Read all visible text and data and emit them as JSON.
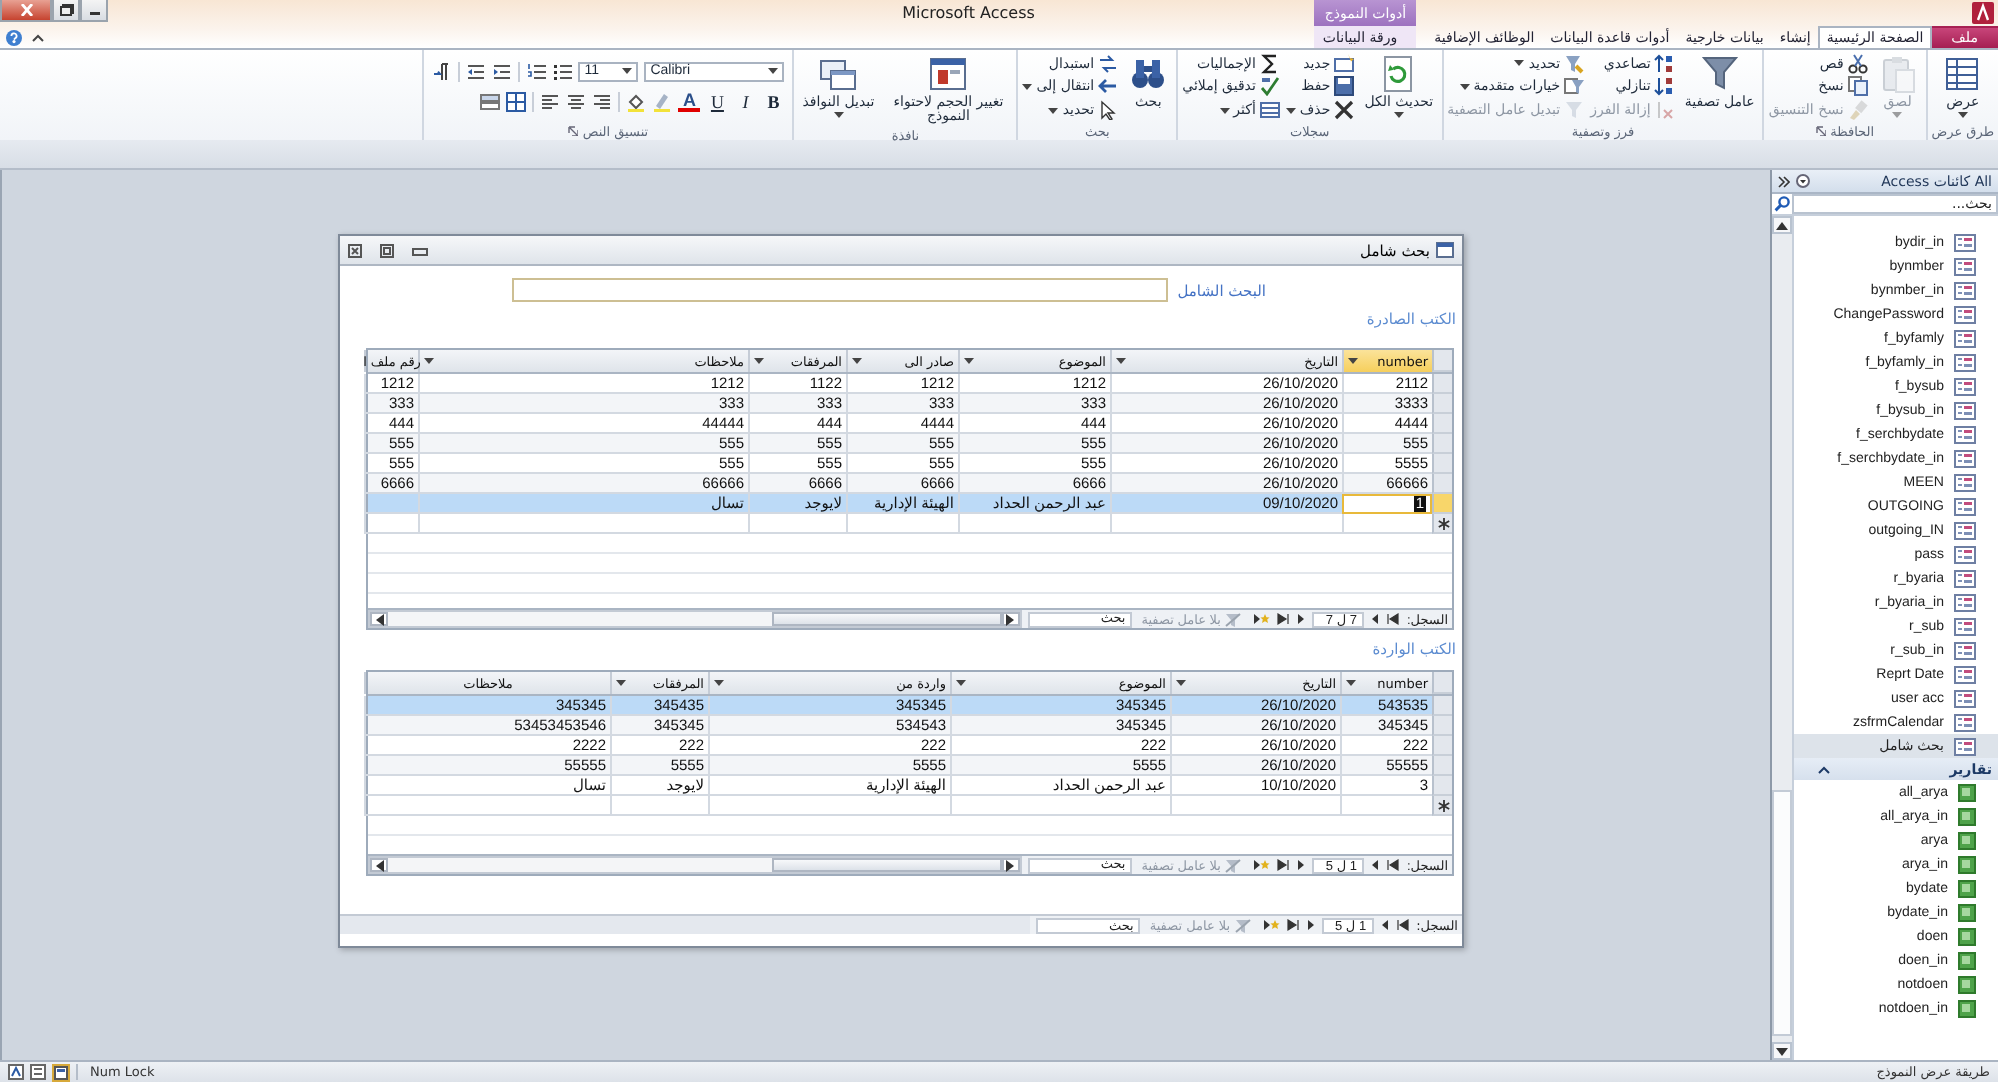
{
  "window": {
    "title": "Microsoft Access"
  },
  "tabs": [
    {
      "label": "ملف",
      "kind": "file",
      "selected": false
    },
    {
      "label": "الصفحة الرئيسية",
      "kind": "tab",
      "selected": true
    },
    {
      "label": "إنشاء",
      "kind": "tab",
      "selected": false
    },
    {
      "label": "بيانات خارجية",
      "kind": "tab",
      "selected": false
    },
    {
      "label": "أدوات قاعدة البيانات",
      "kind": "tab",
      "selected": false
    },
    {
      "label": "الوظائف الإضافية",
      "kind": "tab",
      "selected": false
    },
    {
      "label": "ورقة البيانات",
      "kind": "context",
      "group": "أدوات النموذج",
      "selected": false
    }
  ],
  "ribbon": {
    "groups": [
      {
        "label": "طرق عرض",
        "kind": "buttons",
        "launcher": false,
        "items": [
          {
            "label": "عرض",
            "kind": "large",
            "disabled": false,
            "dropdown": true
          }
        ]
      },
      {
        "label": "الحافظة",
        "kind": "buttons",
        "launcher": true,
        "items": [
          {
            "label": "لصق",
            "kind": "large",
            "disabled": true,
            "dropdown": true
          },
          {
            "label": "قص",
            "kind": "small",
            "disabled": false,
            "dropdown": false
          },
          {
            "label": "نسخ",
            "kind": "small",
            "disabled": false,
            "dropdown": false
          },
          {
            "label": "نسخ التنسيق",
            "kind": "small",
            "disabled": true,
            "dropdown": false
          }
        ]
      },
      {
        "label": "فرز وتصفية",
        "kind": "buttons",
        "launcher": false,
        "items": [
          {
            "label": "عامل تصفية",
            "kind": "large",
            "disabled": false,
            "dropdown": false
          },
          {
            "label": "تصاعدي",
            "kind": "small",
            "disabled": false,
            "dropdown": false
          },
          {
            "label": "تنازلي",
            "kind": "small",
            "disabled": false,
            "dropdown": false
          },
          {
            "label": "إزالة الفرز",
            "kind": "small",
            "disabled": true,
            "dropdown": false
          },
          {
            "label": "تحديد",
            "kind": "small",
            "disabled": false,
            "dropdown": true
          },
          {
            "label": "خيارات متقدمة",
            "kind": "small",
            "disabled": false,
            "dropdown": true
          },
          {
            "label": "تبديل عامل التصفية",
            "kind": "small",
            "disabled": true,
            "dropdown": false
          }
        ]
      },
      {
        "label": "سجلات",
        "kind": "buttons",
        "launcher": false,
        "items": [
          {
            "label": "تحديث الكل",
            "kind": "large",
            "disabled": false,
            "dropdown": true
          },
          {
            "label": "جديد",
            "kind": "small",
            "disabled": false,
            "dropdown": false
          },
          {
            "label": "حفظ",
            "kind": "small",
            "disabled": false,
            "dropdown": false
          },
          {
            "label": "حذف",
            "kind": "small",
            "disabled": false,
            "dropdown": true
          },
          {
            "label": "الإجماليات",
            "kind": "small",
            "disabled": false,
            "dropdown": false
          },
          {
            "label": "تدقيق إملائي",
            "kind": "small",
            "disabled": false,
            "dropdown": false
          },
          {
            "label": "أكثر",
            "kind": "small",
            "disabled": false,
            "dropdown": true
          }
        ]
      },
      {
        "label": "بحث",
        "kind": "buttons",
        "launcher": false,
        "items": [
          {
            "label": "بحث",
            "kind": "large",
            "disabled": false,
            "dropdown": false
          },
          {
            "label": "استبدال",
            "kind": "small",
            "disabled": false,
            "dropdown": false
          },
          {
            "label": "انتقال إلى",
            "kind": "small",
            "disabled": false,
            "dropdown": true
          },
          {
            "label": "تحديد",
            "kind": "small",
            "disabled": false,
            "dropdown": true
          }
        ]
      },
      {
        "label": "نافذة",
        "kind": "buttons",
        "launcher": false,
        "items": [
          {
            "label": "تغيير الحجم لاحتواء النموذج",
            "kind": "large",
            "disabled": false,
            "dropdown": false
          },
          {
            "label": "تبديل النوافذ",
            "kind": "large",
            "disabled": false,
            "dropdown": true
          }
        ]
      },
      {
        "label": "تنسيق النص",
        "kind": "format",
        "launcher": true,
        "font": "Calibri",
        "size": "11",
        "items": [
          {
            "label": "B",
            "kind": "bold"
          },
          {
            "label": "I",
            "kind": "italic"
          },
          {
            "label": "U",
            "kind": "underline"
          },
          {
            "label": "A",
            "kind": "color"
          }
        ]
      }
    ]
  },
  "nav_pane": {
    "title": "All كائنات Access",
    "search": {
      "placeholder": "بحث..."
    },
    "forms": [
      {
        "label": "bydir_in",
        "selected": false
      },
      {
        "label": "bynmber",
        "selected": false
      },
      {
        "label": "bynmber_in",
        "selected": false
      },
      {
        "label": "ChangePassword",
        "selected": false
      },
      {
        "label": "f_byfamly",
        "selected": false
      },
      {
        "label": "f_byfamly_in",
        "selected": false
      },
      {
        "label": "f_bysub",
        "selected": false
      },
      {
        "label": "f_bysub_in",
        "selected": false
      },
      {
        "label": "f_serchbydate",
        "selected": false
      },
      {
        "label": "f_serchbydate_in",
        "selected": false
      },
      {
        "label": "MEEN",
        "selected": false
      },
      {
        "label": "OUTGOING",
        "selected": false
      },
      {
        "label": "outgoing_IN",
        "selected": false
      },
      {
        "label": "pass",
        "selected": false
      },
      {
        "label": "r_byaria",
        "selected": false
      },
      {
        "label": "r_byaria_in",
        "selected": false
      },
      {
        "label": "r_sub",
        "selected": false
      },
      {
        "label": "r_sub_in",
        "selected": false
      },
      {
        "label": "Reprt Date",
        "selected": false
      },
      {
        "label": "user acc",
        "selected": false
      },
      {
        "label": "zsfrmCalendar",
        "selected": false
      },
      {
        "label": "بحث شامل",
        "selected": true
      }
    ],
    "reports": {
      "title": "تقارير",
      "items": [
        {
          "label": "all_arya",
          "selected": false
        },
        {
          "label": "all_arya_in",
          "selected": false
        },
        {
          "label": "arya",
          "selected": false
        },
        {
          "label": "arya_in",
          "selected": false
        },
        {
          "label": "bydate",
          "selected": false
        },
        {
          "label": "bydate_in",
          "selected": false
        },
        {
          "label": "doen",
          "selected": false
        },
        {
          "label": "doen_in",
          "selected": false
        },
        {
          "label": "notdoen",
          "selected": false
        },
        {
          "label": "notdoen_in",
          "selected": false
        }
      ]
    }
  },
  "form": {
    "title": "بحث شامل",
    "search": {
      "label": "البحث الشامل"
    },
    "subforms": [
      {
        "title": "الكتب الصادرة",
        "columns": [
          {
            "label": "number",
            "selected": true,
            "dropdown": true
          },
          {
            "label": "التاريخ",
            "selected": false,
            "dropdown": true
          },
          {
            "label": "الموضوع",
            "selected": false,
            "dropdown": true
          },
          {
            "label": "صادر الى",
            "selected": false,
            "dropdown": true
          },
          {
            "label": "المرفقات",
            "selected": false,
            "dropdown": true
          },
          {
            "label": "ملاحظات",
            "selected": false,
            "dropdown": true
          },
          {
            "label": "رقم ملف ا",
            "selected": false,
            "dropdown": false
          }
        ],
        "rows": [
          {
            "cells": [
              "2112",
              "26/10/2020",
              "1212",
              "1212",
              "1122",
              "1212",
              "1212"
            ],
            "selected": false,
            "editing": false
          },
          {
            "cells": [
              "3333",
              "26/10/2020",
              "333",
              "333",
              "333",
              "333",
              "333"
            ],
            "selected": false,
            "editing": false
          },
          {
            "cells": [
              "4444",
              "26/10/2020",
              "444",
              "4444",
              "444",
              "44444",
              "444"
            ],
            "selected": false,
            "editing": false
          },
          {
            "cells": [
              "555",
              "26/10/2020",
              "555",
              "555",
              "555",
              "555",
              "555"
            ],
            "selected": false,
            "editing": false
          },
          {
            "cells": [
              "5555",
              "26/10/2020",
              "555",
              "555",
              "555",
              "555",
              "555"
            ],
            "selected": false,
            "editing": false
          },
          {
            "cells": [
              "66666",
              "26/10/2020",
              "6666",
              "6666",
              "6666",
              "66666",
              "6666"
            ],
            "selected": false,
            "editing": false
          },
          {
            "cells": [
              "1",
              "09/10/2020",
              "عبد الرحمن الحداد",
              "الهيئة الإدارية",
              "لايوجد",
              "تسال",
              null
            ],
            "selected": true,
            "editing": true
          }
        ],
        "navigator": {
          "label": "السجل:",
          "position": "7 ل 7",
          "filter": "بلا عامل تصفية",
          "placeholder": "بحث"
        }
      },
      {
        "title": "الكتب الواردة",
        "columns": [
          {
            "label": "number",
            "selected": false,
            "dropdown": true
          },
          {
            "label": "التاريخ",
            "selected": false,
            "dropdown": true
          },
          {
            "label": "الموضوع",
            "selected": false,
            "dropdown": true
          },
          {
            "label": "واردة من",
            "selected": false,
            "dropdown": true
          },
          {
            "label": "المرفقات",
            "selected": false,
            "dropdown": true
          },
          {
            "label": "ملاحظات",
            "selected": false,
            "dropdown": false
          }
        ],
        "rows": [
          {
            "cells": [
              "543535",
              "26/10/2020",
              "345345",
              "345345",
              "345435",
              "345345"
            ],
            "selected": true,
            "editing": false
          },
          {
            "cells": [
              "345345",
              "26/10/2020",
              "345345",
              "534543",
              "345345",
              "53453453546"
            ],
            "selected": false,
            "editing": false
          },
          {
            "cells": [
              "222",
              "26/10/2020",
              "222",
              "222",
              "222",
              "2222"
            ],
            "selected": false,
            "editing": false
          },
          {
            "cells": [
              "55555",
              "26/10/2020",
              "5555",
              "5555",
              "5555",
              "55555"
            ],
            "selected": false,
            "editing": false
          },
          {
            "cells": [
              "3",
              "10/10/2020",
              "عبد الرحمن الحداد",
              "الهيئة الإدارية",
              "لايوجد",
              "تسال"
            ],
            "selected": false,
            "editing": false
          }
        ],
        "navigator": {
          "label": "السجل:",
          "position": "1 ل 5",
          "filter": "بلا عامل تصفية",
          "placeholder": "بحث"
        }
      }
    ],
    "navigator": {
      "label": "السجل:",
      "position": "1 ل 5",
      "filter": "بلا عامل تصفية",
      "placeholder": "بحث"
    }
  },
  "status_bar": {
    "left": "Num Lock",
    "right": "طريقة عرض النموذج"
  }
}
